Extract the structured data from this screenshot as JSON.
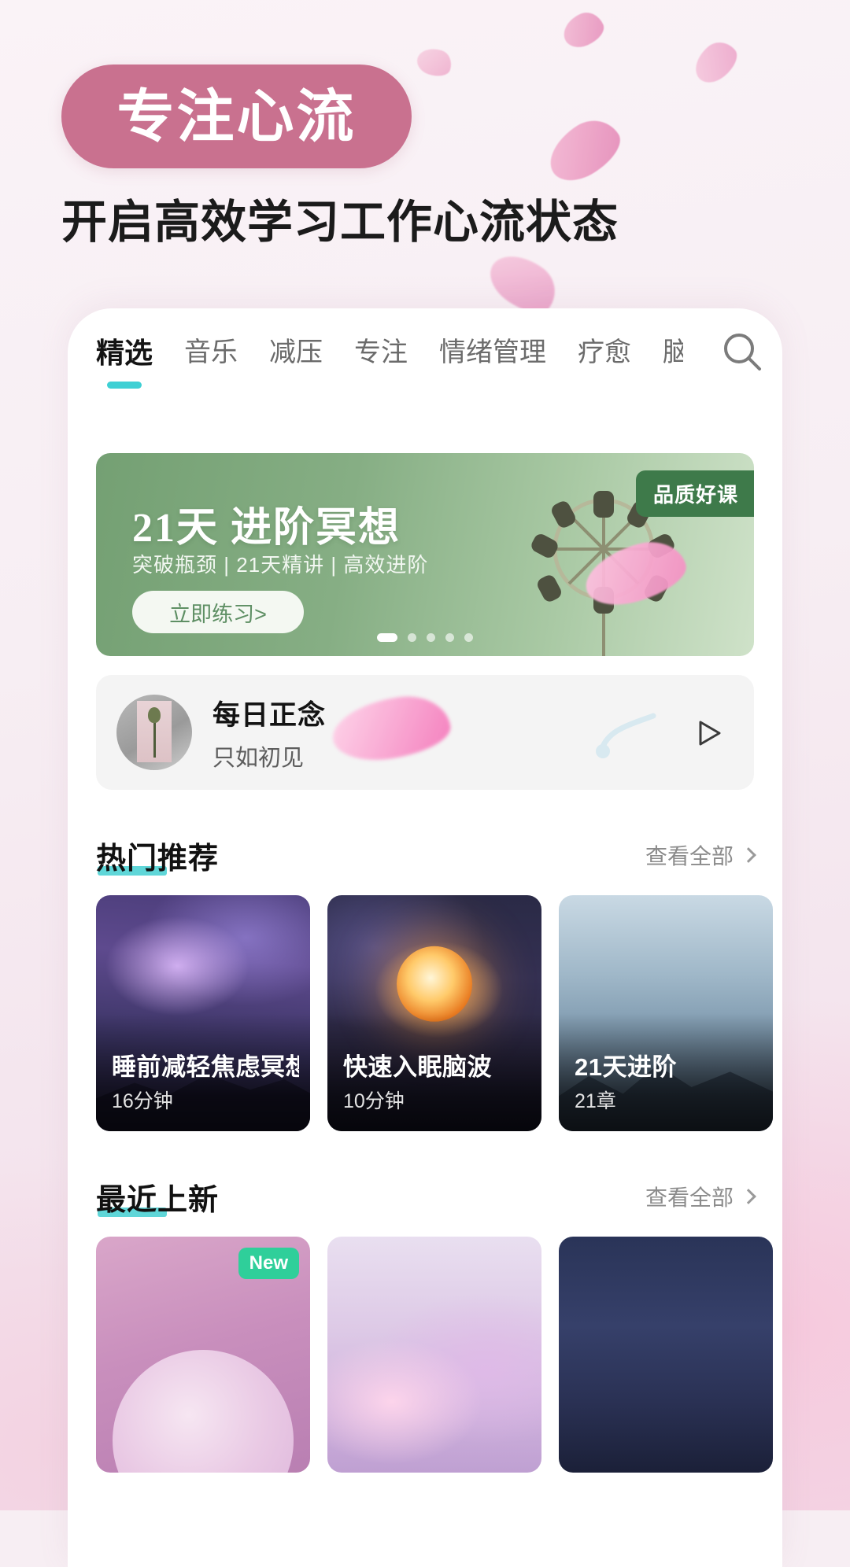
{
  "promo": {
    "badge_title": "专注心流",
    "subtitle": "开启高效学习工作心流状态",
    "badge_color": "#c9718f",
    "accent_color": "#3fd0d4"
  },
  "app": {
    "tabs": [
      {
        "label": "精选",
        "active": true
      },
      {
        "label": "音乐",
        "active": false
      },
      {
        "label": "减压",
        "active": false
      },
      {
        "label": "专注",
        "active": false
      },
      {
        "label": "情绪管理",
        "active": false
      },
      {
        "label": "疗愈",
        "active": false
      },
      {
        "label": "脑",
        "active": false
      }
    ],
    "search_icon": "search-icon",
    "banner": {
      "badge": "品质好课",
      "title": "21天 进阶冥想",
      "subtitle": "突破瓶颈 | 21天精讲 | 高效进阶",
      "cta": "立即练习>",
      "dots_total": 5,
      "dots_active_index": 0,
      "art_icon": "wind-chime-icon"
    },
    "daily": {
      "title": "每日正念",
      "subtitle": "只如初见",
      "thumb_icon": "rose-photo-icon",
      "note_icon": "music-note-icon",
      "play_icon": "play-icon"
    },
    "sections": [
      {
        "title": "热门推荐",
        "more_label": "查看全部",
        "cards": [
          {
            "title": "睡前减轻焦虑冥想",
            "meta": "16分钟",
            "art": "art-galaxy1",
            "badge": ""
          },
          {
            "title": "快速入眠脑波",
            "meta": "10分钟",
            "art": "art-galaxy2",
            "badge": ""
          },
          {
            "title": "21天进阶",
            "meta": "21章",
            "art": "art-mountain",
            "badge": ""
          }
        ]
      },
      {
        "title": "最近上新",
        "more_label": "查看全部",
        "cards": [
          {
            "title": "",
            "meta": "",
            "art": "art-pinkcircle",
            "badge": "New"
          },
          {
            "title": "",
            "meta": "",
            "art": "art-clouds",
            "badge": ""
          },
          {
            "title": "",
            "meta": "",
            "art": "art-night",
            "badge": ""
          }
        ]
      }
    ]
  }
}
